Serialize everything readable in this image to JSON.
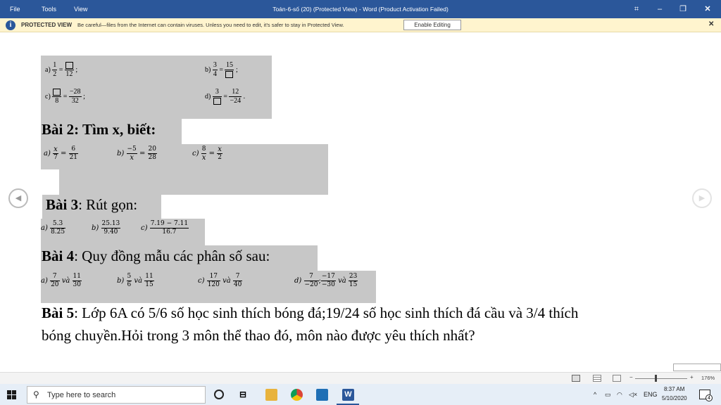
{
  "menu": {
    "file": "File",
    "tools": "Tools",
    "view": "View"
  },
  "window_title": "Toán-6-số (20) (Protected View) - Word (Product Activation Failed)",
  "window_buttons": {
    "restore": "⌗",
    "minimize": "–",
    "maximize": "❐",
    "close": "✕"
  },
  "protected": {
    "title": "PROTECTED VIEW",
    "message": "Be careful—files from the Internet can contain viruses. Unless you need to edit, it's safer to stay in Protected View.",
    "enable_button": "Enable Editing",
    "close": "✕"
  },
  "doc": {
    "ex1": {
      "a_label": "a)",
      "a_n1": "1",
      "a_d1": "2",
      "a_d2": "12",
      "a_tail": ";",
      "b_label": "b)",
      "b_n1": "3",
      "b_d1": "4",
      "b_n2": "15",
      "b_tail": ";",
      "c_label": "c)",
      "c_d1": "8",
      "c_n2": "−28",
      "c_d2": "32",
      "c_tail": ";",
      "d_label": "d)",
      "d_n1": "3",
      "d_n2": "12",
      "d_d2": "−24",
      "d_tail": "."
    },
    "bai2": {
      "title": "Bài 2: Tìm x, biết:",
      "a_label": "a)",
      "a_n1": "x",
      "a_d1": "7",
      "a_n2": "6",
      "a_d2": "21",
      "b_label": "b)",
      "b_n1": "−5",
      "b_d1": "x",
      "b_n2": "20",
      "b_d2": "28",
      "c_label": "c)",
      "c_n1": "8",
      "c_d1": "x",
      "c_n2": "x",
      "c_d2": "2"
    },
    "bai3": {
      "title_bold": "Bài 3",
      "title_rest": ": Rút gọn:",
      "a_label": "a)",
      "a_n": "5.3",
      "a_d": "8.25",
      "b_label": "b)",
      "b_n": "25.13",
      "b_d": "9.40",
      "c_label": "c)",
      "c_n": "7.19 − 7.11",
      "c_d": "16.7"
    },
    "bai4": {
      "title_bold": "Bài 4",
      "title_rest": ": Quy đồng mẫu các phân số sau:",
      "a_label": "a)",
      "a_n1": "7",
      "a_d1": "20",
      "a_va": "và",
      "a_n2": "11",
      "a_d2": "30",
      "b_label": "b)",
      "b_n1": "5",
      "b_d1": "6",
      "b_va": "và",
      "b_n2": "11",
      "b_d2": "15",
      "c_label": "c)",
      "c_n1": "17",
      "c_d1": "120",
      "c_va": "và",
      "c_n2": "7",
      "c_d2": "40",
      "d_label": "d)",
      "d_n1": "7",
      "d_d1": "−20",
      "d_sep": ";",
      "d_n2": "−17",
      "d_d2": "−30",
      "d_va": "và",
      "d_n3": "23",
      "d_d3": "15"
    },
    "bai5": {
      "title_bold": "Bài 5",
      "line1": ": Lớp 6A có 5/6 số học sinh thích bóng đá;19/24 số học sinh thích đá cầu và 3/4 thích",
      "line2": "bóng chuyền.Hỏi trong 3 môn thể thao đó, môn nào được yêu thích nhất?"
    }
  },
  "nav": {
    "prev": "◀",
    "next": "▶"
  },
  "status": {
    "zoom": "176%",
    "minus": "−",
    "plus": "+"
  },
  "taskbar": {
    "search_placeholder": "Type here to search",
    "time": "8:37 AM",
    "date": "5/10/2020",
    "lang": "ENG",
    "notif_count": "4",
    "accent": "#2b579a"
  }
}
